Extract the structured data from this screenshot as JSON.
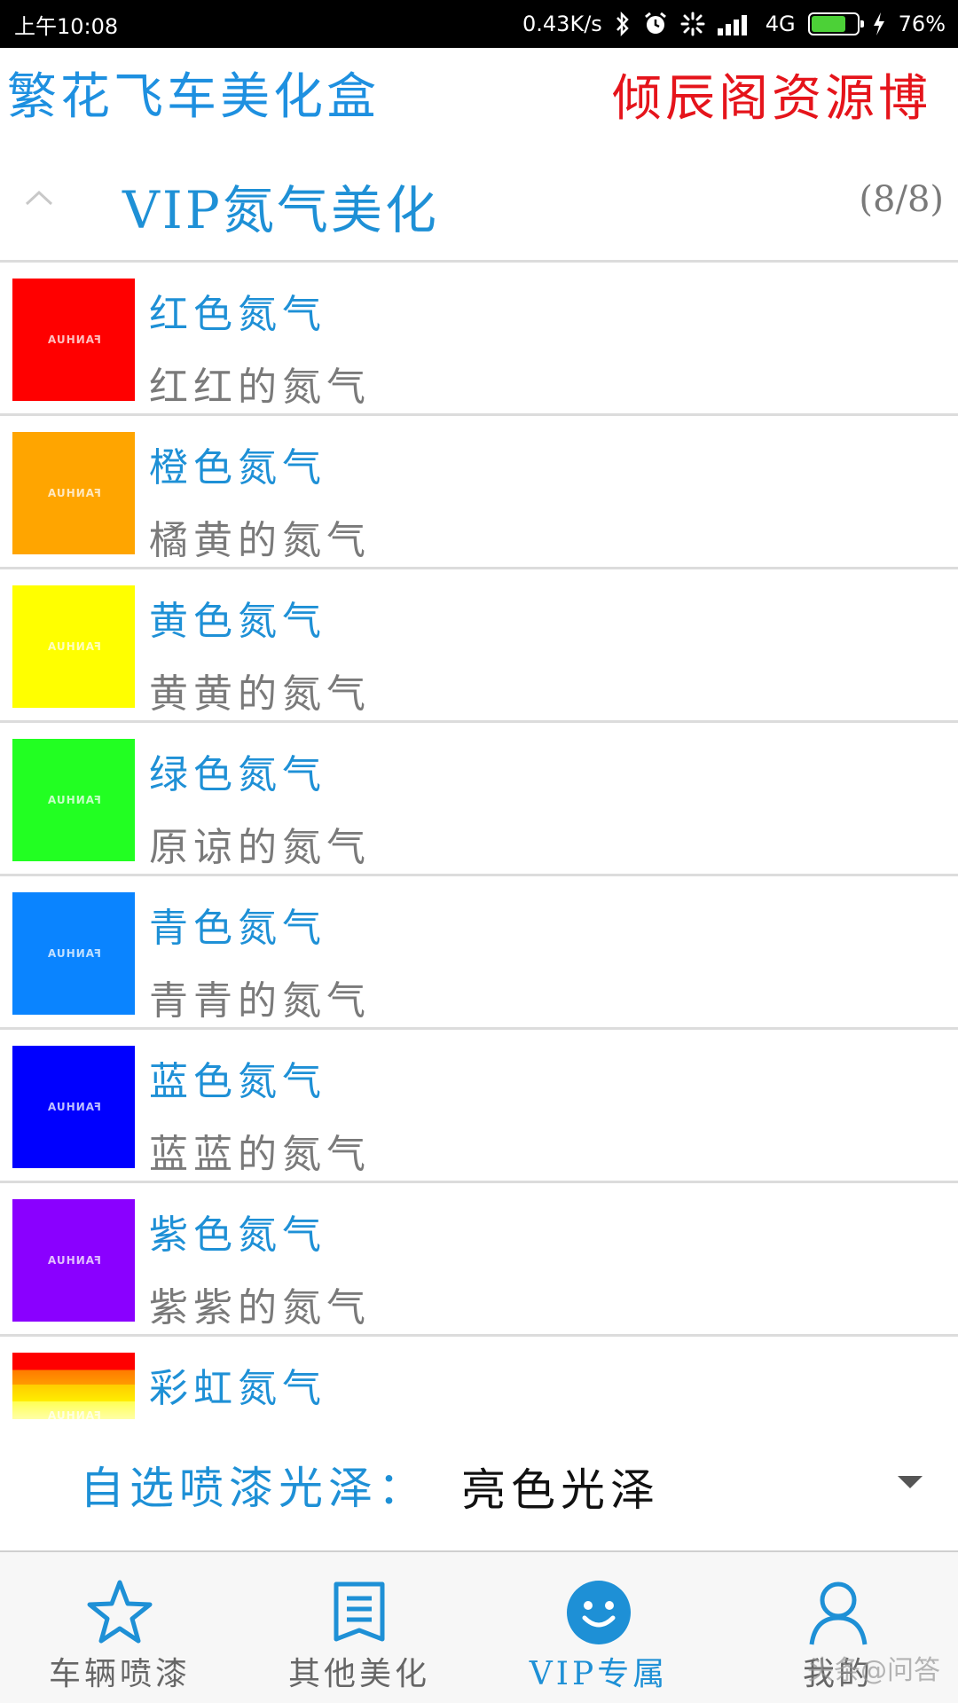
{
  "status_bar": {
    "time": "上午10:08",
    "network_speed": "0.43K/s",
    "network_type": "4G",
    "battery": "76%"
  },
  "banner": {
    "left_text": "繁花飞车美化盒",
    "right_text": "倾辰阁资源博"
  },
  "section": {
    "title": "VIP氮气美化",
    "count": "(8/8)"
  },
  "items": [
    {
      "title": "红色氮气",
      "desc": "红红的氮气",
      "color": "#ff0000",
      "thumb_text": "FANHUA"
    },
    {
      "title": "橙色氮气",
      "desc": "橘黄的氮气",
      "color": "#ffa500",
      "thumb_text": "FANHUA"
    },
    {
      "title": "黄色氮气",
      "desc": "黄黄的氮气",
      "color": "#ffff00",
      "thumb_text": "FANHUA"
    },
    {
      "title": "绿色氮气",
      "desc": "原谅的氮气",
      "color": "#22ff22",
      "thumb_text": "FANHUA"
    },
    {
      "title": "青色氮气",
      "desc": "青青的氮气",
      "color": "#0a84ff",
      "thumb_text": "FANHUA"
    },
    {
      "title": "蓝色氮气",
      "desc": "蓝蓝的氮气",
      "color": "#0000ff",
      "thumb_text": "FANHUA"
    },
    {
      "title": "紫色氮气",
      "desc": "紫紫的氮气",
      "color": "#8a00ff",
      "thumb_text": "FANHUA"
    },
    {
      "title": "彩虹氮气",
      "desc": "",
      "color": "rainbow",
      "thumb_text": "FANHUA"
    }
  ],
  "gloss": {
    "label": "自选喷漆光泽：",
    "value": "亮色光泽"
  },
  "nav": [
    {
      "label": "车辆喷漆",
      "icon": "star-icon"
    },
    {
      "label": "其他美化",
      "icon": "book-icon"
    },
    {
      "label": "VIP专属",
      "icon": "smiley-icon"
    },
    {
      "label": "我的",
      "icon": "user-icon"
    }
  ],
  "watermark": "头条@问答",
  "colors": {
    "accent": "#1e90d6",
    "banner_right": "#e5141b",
    "muted": "#7a7a7a"
  }
}
